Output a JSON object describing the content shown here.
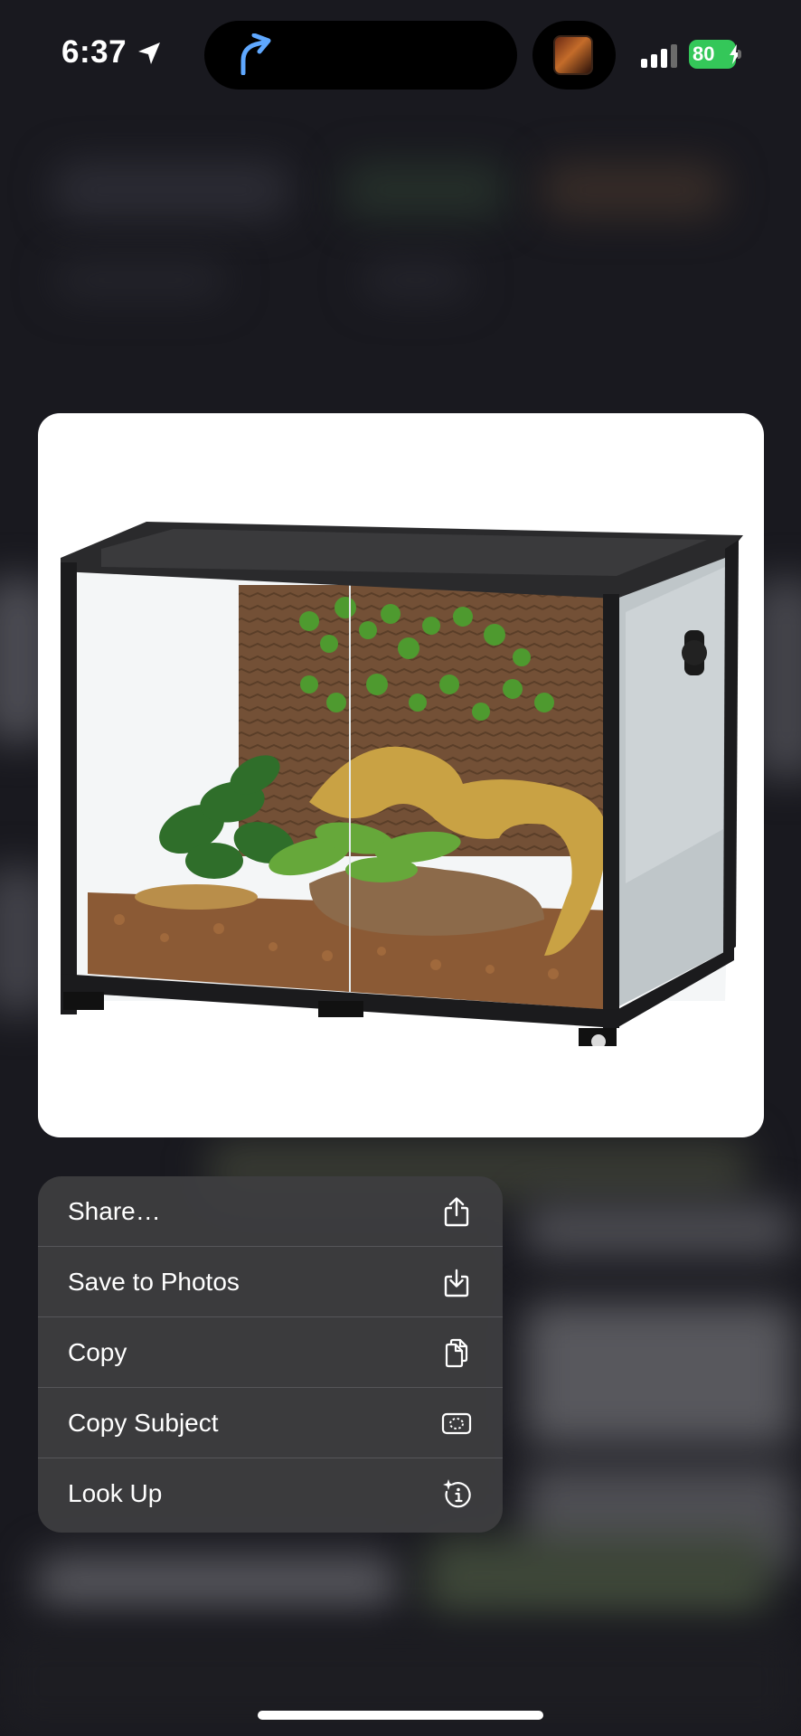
{
  "status_bar": {
    "time": "6:37",
    "battery": "80"
  },
  "preview": {
    "subject": "glass-terrarium-photo"
  },
  "context_menu": {
    "items": [
      {
        "label": "Share…",
        "icon": "share-icon"
      },
      {
        "label": "Save to Photos",
        "icon": "save-to-photos-icon"
      },
      {
        "label": "Copy",
        "icon": "copy-icon"
      },
      {
        "label": "Copy Subject",
        "icon": "copy-subject-icon"
      },
      {
        "label": "Look Up",
        "icon": "look-up-icon"
      }
    ]
  },
  "colors": {
    "battery": "#34c759",
    "menu_background": "#3e3e40",
    "backdrop": "#1c1c22",
    "nav_accent": "#5fa8ff"
  }
}
